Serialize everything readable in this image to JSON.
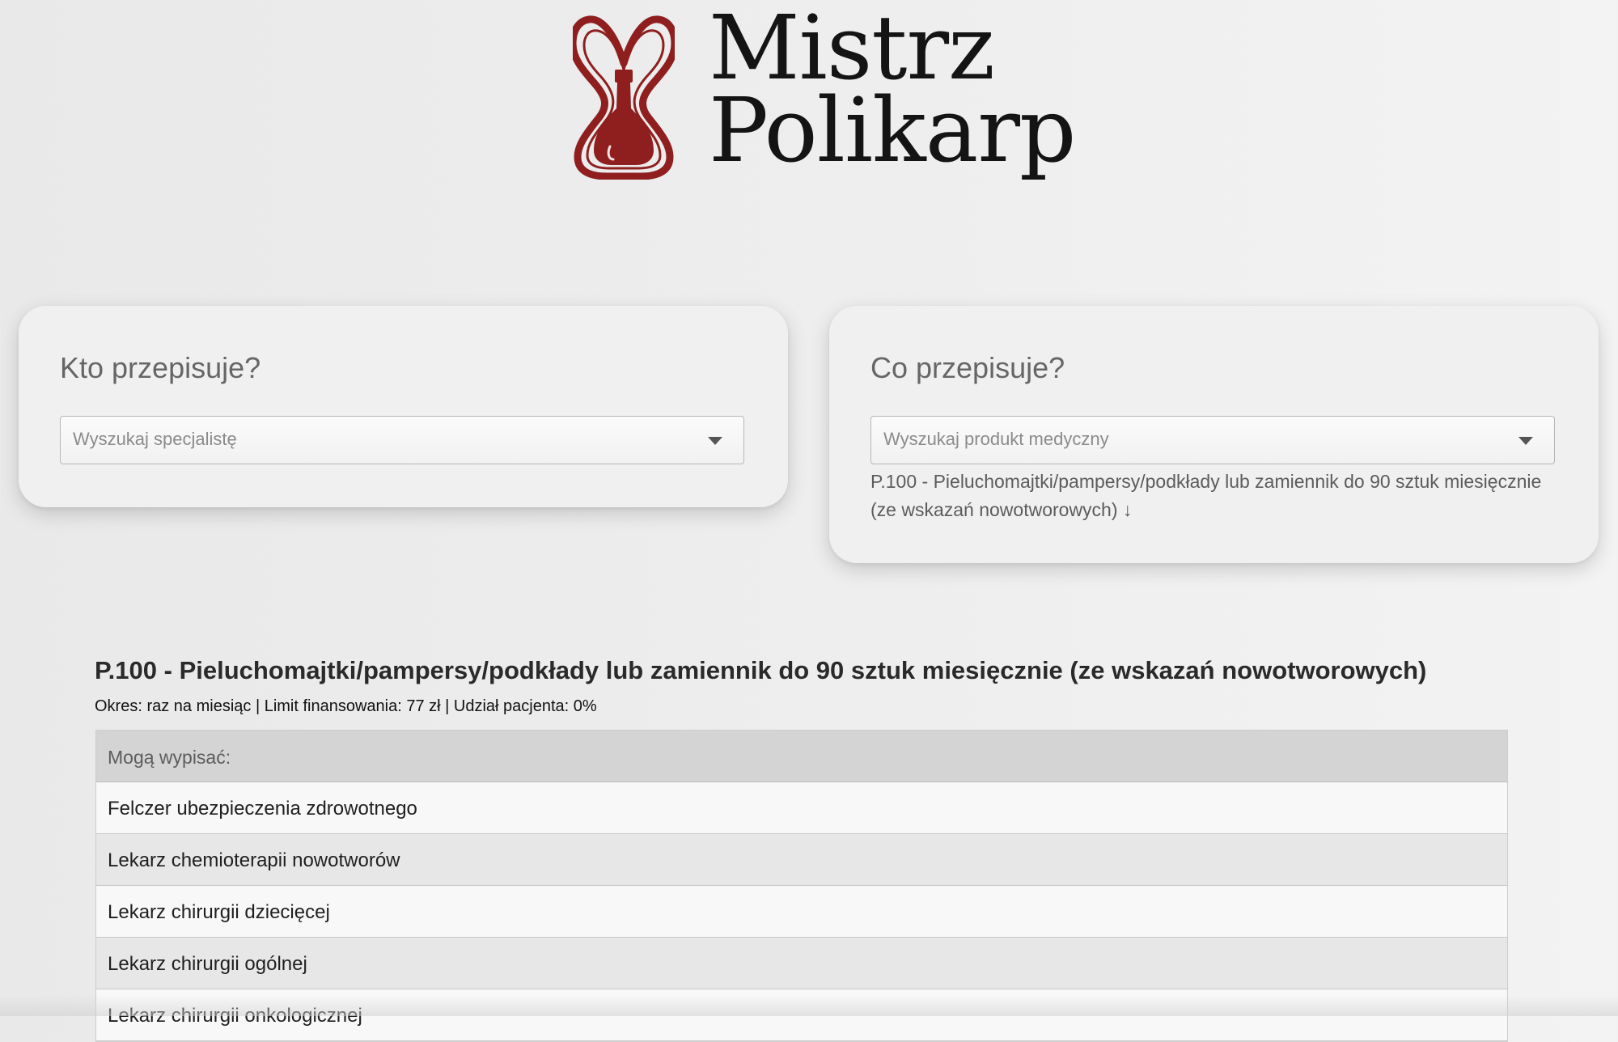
{
  "brand": {
    "icon": "heart-hourglass-icon",
    "line1": "Mistrz",
    "line2": "Polikarp",
    "accent_color": "#8f1f1f"
  },
  "search_cards": {
    "specialist": {
      "title": "Kto przepisuje?",
      "placeholder": "Wyszukaj specjalistę",
      "caret_icon": "caret-down-icon"
    },
    "product": {
      "title": "Co przepisuje?",
      "placeholder": "Wyszukaj produkt medyczny",
      "caret_icon": "caret-down-icon",
      "selected_text": "P.100 - Pieluchomajtki/pampersy/podkłady lub zamiennik do 90 sztuk miesięcznie (ze wskazań nowotworowych) ↓"
    }
  },
  "result": {
    "title": "P.100 - Pieluchomajtki/pampersy/podkłady lub zamiennik do 90 sztuk miesięcznie (ze wskazań nowotworowych)",
    "meta": "Okres: raz na miesiąc | Limit finansowania: 77 zł | Udział pacjenta: 0%",
    "table_header": "Mogą wypisać:",
    "rows": [
      "Felczer ubezpieczenia zdrowotnego",
      "Lekarz chemioterapii nowotworów",
      "Lekarz chirurgii dziecięcej",
      "Lekarz chirurgii ogólnej",
      "Lekarz chirurgii onkologicznej"
    ]
  }
}
